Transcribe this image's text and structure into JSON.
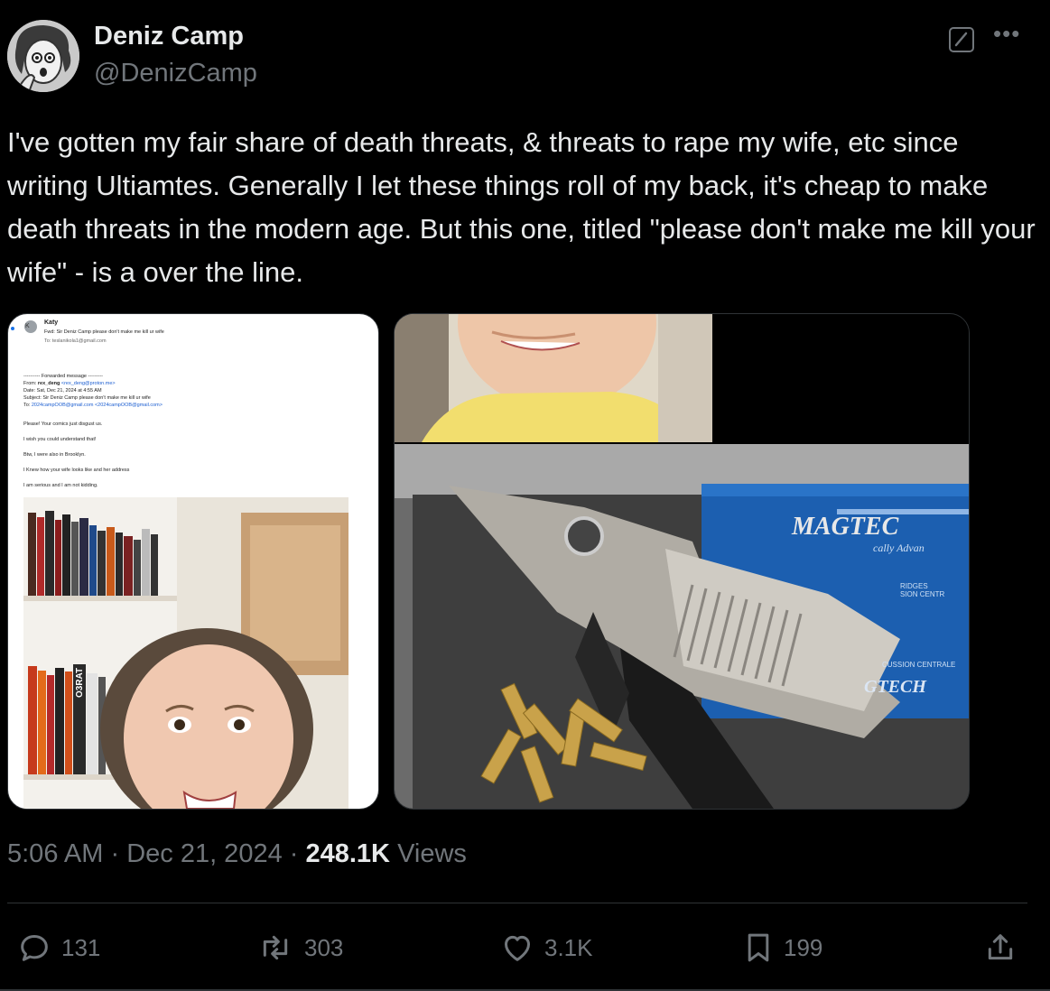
{
  "author": {
    "name": "Deniz Camp",
    "handle": "@DenizCamp"
  },
  "tweet": {
    "text": "I've gotten my fair share of death threats, & threats to rape my wife, etc since writing Ultiamtes. Generally I let these things roll of my back, it's cheap to make death threats in the modern age. But this one, titled \"please don't make me kill your wife\" - is a over the line.",
    "time": "5:06 AM",
    "date": "Dec 21, 2024",
    "views_count": "248.1K",
    "views_label": "Views"
  },
  "email": {
    "avatar_letter": "K",
    "sender": "Katy",
    "subject_line": "Fwd: Sir Deniz Camp please don't make me kill ur wife",
    "to_line": "To:  teslanikola1@gmail.com",
    "forwarded_header": "---------- Forwarded message ---------",
    "from_label": "From: ",
    "from_name": "rex_deng",
    "from_addr": "<rex_deng@proton.me>",
    "date_line": "Date: Sat, Dec 21, 2024 at 4:55 AM",
    "subject_fwd": "Subject: Sir Deniz Camp please don't make me kill ur wife",
    "to_fwd_label": "To: ",
    "to_fwd_addr": "2024campOOB@gmail.com <2024campOOB@gmail.com>",
    "body": [
      "Please!   Your comics just disgust us.",
      "I wish you could understand that!",
      "Btw, I were also in Brooklyn.",
      "I Knew how your wife looks like and her address",
      "I am serious and I am not kidding."
    ]
  },
  "photo": {
    "box_brand": "MAGTEC",
    "box_sub": "cally Advan",
    "box_small_1": "RIDGES",
    "box_small_2": "SION CENTR",
    "box_small_3": "CUSSION CENTRALE",
    "box_brand_2": "GTECH",
    "shelf_book": "O3RAT"
  },
  "actions": {
    "reply": "131",
    "repost": "303",
    "like": "3.1K",
    "bookmark": "199"
  },
  "colors": {
    "background": "#000000",
    "text": "#e7e9ea",
    "secondary": "#71767b",
    "divider": "#2f3336",
    "link": "#1d5fd1"
  }
}
